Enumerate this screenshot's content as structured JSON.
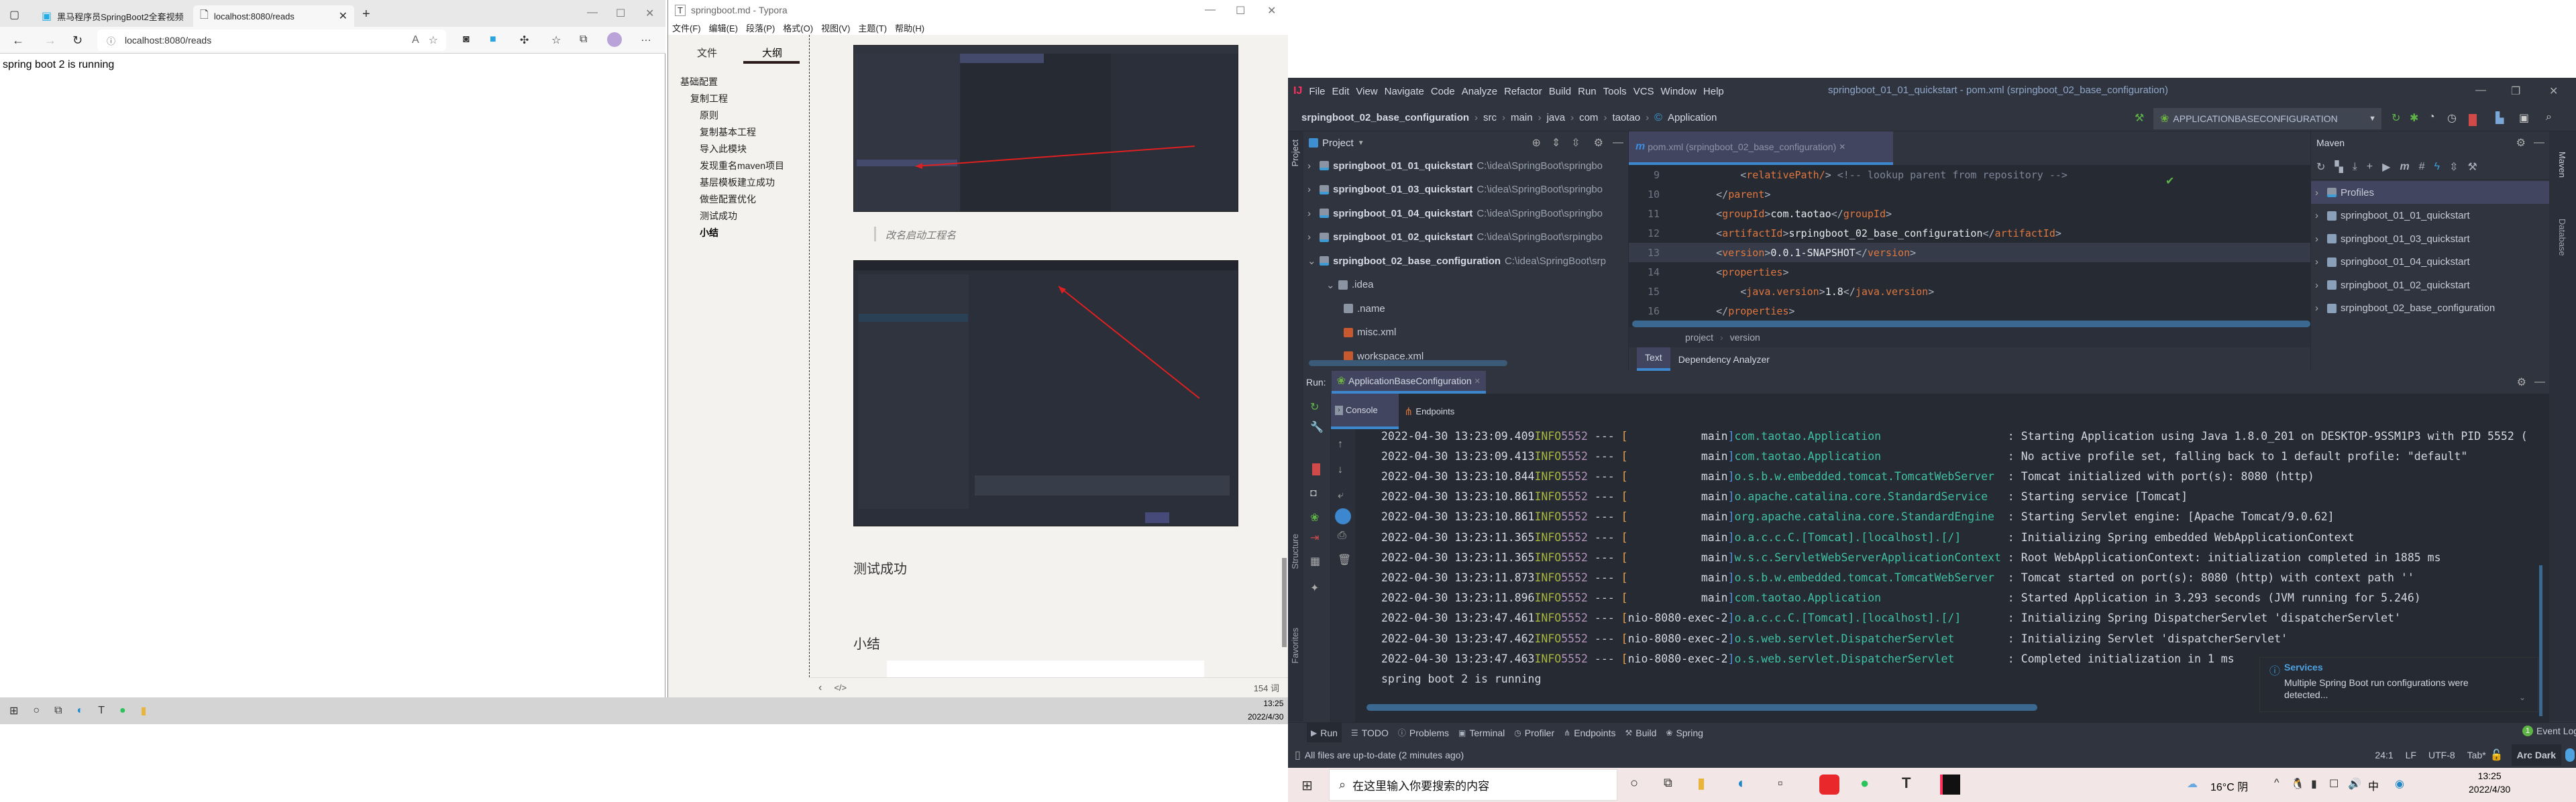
{
  "browser": {
    "tabs": [
      {
        "label": "黑马程序员SpringBoot2全套视频",
        "icon": "bilibili-icon"
      },
      {
        "label": "localhost:8080/reads",
        "icon": "page-icon"
      }
    ],
    "address": "localhost:8080/reads",
    "body_text": "spring boot 2 is running"
  },
  "typora": {
    "title": "springboot.md - Typora",
    "menu": [
      "文件(F)",
      "编辑(E)",
      "段落(P)",
      "格式(O)",
      "视图(V)",
      "主题(T)",
      "帮助(H)"
    ],
    "sidebar_tabs": [
      "文件",
      "大纲"
    ],
    "active_sidebar_tab": "大纲",
    "outline": [
      {
        "label": "基础配置",
        "level": 1
      },
      {
        "label": "复制工程",
        "level": 2
      },
      {
        "label": "原则",
        "level": 3
      },
      {
        "label": "复制基本工程",
        "level": 3
      },
      {
        "label": "导入此模块",
        "level": 3
      },
      {
        "label": "发现重名maven项目",
        "level": 3
      },
      {
        "label": "基层模板建立成功",
        "level": 3
      },
      {
        "label": "做些配置优化",
        "level": 3
      },
      {
        "label": "测试成功",
        "level": 3
      },
      {
        "label": "小结",
        "level": 3,
        "active": true
      }
    ],
    "caption": "改名启动工程名",
    "heading1": "测试成功",
    "heading2": "小结",
    "word_count": "154 词"
  },
  "idea": {
    "menu": [
      "File",
      "Edit",
      "View",
      "Navigate",
      "Code",
      "Analyze",
      "Refactor",
      "Build",
      "Run",
      "Tools",
      "VCS",
      "Window",
      "Help"
    ],
    "window_title": "springboot_01_01_quickstart - pom.xml (srpingboot_02_base_configuration)",
    "breadcrumb": [
      "srpingboot_02_base_configuration",
      "src",
      "main",
      "java",
      "com",
      "taotao",
      "Application"
    ],
    "run_config": "APPLICATIONBASECONFIGURATION",
    "project_label": "Project",
    "project_tree": [
      {
        "name": "springboot_01_01_quickstart",
        "path": "C:\\idea\\SpringBoot\\springbo",
        "expanded": false
      },
      {
        "name": "springboot_01_03_quickstart",
        "path": "C:\\idea\\SpringBoot\\springbo",
        "expanded": false
      },
      {
        "name": "springboot_01_04_quickstart",
        "path": "C:\\idea\\SpringBoot\\springbo",
        "expanded": false
      },
      {
        "name": "srpingboot_01_02_quickstart",
        "path": "C:\\idea\\SpringBoot\\srpingbo",
        "expanded": false
      },
      {
        "name": "srpingboot_02_base_configuration",
        "path": "C:\\idea\\SpringBoot\\srp",
        "expanded": true
      }
    ],
    "tree_children": [
      {
        "name": ".idea",
        "type": "folder"
      },
      {
        "name": ".name",
        "type": "file"
      },
      {
        "name": "misc.xml",
        "type": "xml"
      },
      {
        "name": "workspace.xml",
        "type": "xml"
      }
    ],
    "editor_tab": "pom.xml (srpingboot_02_base_configuration)",
    "code": [
      {
        "n": "9",
        "indent": "        ",
        "tag": "relativePath/",
        "rest": " <!-- lookup parent from repository -->"
      },
      {
        "n": "10",
        "indent": "    ",
        "close": "parent"
      },
      {
        "n": "11",
        "indent": "    ",
        "tag": "groupId",
        "val": "com.taotao"
      },
      {
        "n": "12",
        "indent": "    ",
        "tag": "artifactId",
        "val": "srpingboot_02_base_configuration"
      },
      {
        "n": "13",
        "indent": "    ",
        "tag": "version",
        "val": "0.0.1-SNAPSHOT",
        "current": true
      },
      {
        "n": "14",
        "indent": "    ",
        "open": "properties"
      },
      {
        "n": "15",
        "indent": "        ",
        "tag": "java.version",
        "val": "1.8"
      },
      {
        "n": "16",
        "indent": "    ",
        "close": "properties"
      }
    ],
    "editor_breadcrumb": [
      "project",
      "version"
    ],
    "editor_bottom_tabs": [
      "Text",
      "Dependency Analyzer"
    ],
    "maven": {
      "title": "Maven",
      "items": [
        "Profiles",
        "springboot_01_01_quickstart",
        "springboot_01_03_quickstart",
        "springboot_01_04_quickstart",
        "srpingboot_01_02_quickstart",
        "srpingboot_02_base_configuration"
      ]
    },
    "right_strip": [
      "Maven",
      "Database"
    ],
    "left_strip": [
      "Project",
      "Structure",
      "Favorites"
    ],
    "run": {
      "label": "Run:",
      "config": "ApplicationBaseConfiguration",
      "tabs": [
        "Console",
        "Endpoints"
      ]
    },
    "logs": [
      {
        "ts": "2022-04-30 13:23:09.409",
        "lv": "INFO",
        "pid": "5552",
        "th": "main",
        "lo": "com.taotao.Application",
        "msg": "Starting Application using Java 1.8.0_201 on DESKTOP-9SSM1P3 with PID 5552 ("
      },
      {
        "ts": "2022-04-30 13:23:09.413",
        "lv": "INFO",
        "pid": "5552",
        "th": "main",
        "lo": "com.taotao.Application",
        "msg": "No active profile set, falling back to 1 default profile: \"default\""
      },
      {
        "ts": "2022-04-30 13:23:10.844",
        "lv": "INFO",
        "pid": "5552",
        "th": "main",
        "lo": "o.s.b.w.embedded.tomcat.TomcatWebServer",
        "msg": "Tomcat initialized with port(s): 8080 (http)"
      },
      {
        "ts": "2022-04-30 13:23:10.861",
        "lv": "INFO",
        "pid": "5552",
        "th": "main",
        "lo": "o.apache.catalina.core.StandardService",
        "msg": "Starting service [Tomcat]"
      },
      {
        "ts": "2022-04-30 13:23:10.861",
        "lv": "INFO",
        "pid": "5552",
        "th": "main",
        "lo": "org.apache.catalina.core.StandardEngine",
        "msg": "Starting Servlet engine: [Apache Tomcat/9.0.62]"
      },
      {
        "ts": "2022-04-30 13:23:11.365",
        "lv": "INFO",
        "pid": "5552",
        "th": "main",
        "lo": "o.a.c.c.C.[Tomcat].[localhost].[/]",
        "msg": "Initializing Spring embedded WebApplicationContext"
      },
      {
        "ts": "2022-04-30 13:23:11.365",
        "lv": "INFO",
        "pid": "5552",
        "th": "main",
        "lo": "w.s.c.ServletWebServerApplicationContext",
        "msg": "Root WebApplicationContext: initialization completed in 1885 ms"
      },
      {
        "ts": "2022-04-30 13:23:11.873",
        "lv": "INFO",
        "pid": "5552",
        "th": "main",
        "lo": "o.s.b.w.embedded.tomcat.TomcatWebServer",
        "msg": "Tomcat started on port(s): 8080 (http) with context path ''"
      },
      {
        "ts": "2022-04-30 13:23:11.896",
        "lv": "INFO",
        "pid": "5552",
        "th": "main",
        "lo": "com.taotao.Application",
        "msg": "Started Application in 3.293 seconds (JVM running for 5.246)"
      },
      {
        "ts": "2022-04-30 13:23:47.461",
        "lv": "INFO",
        "pid": "5552",
        "th": "nio-8080-exec-2",
        "lo": "o.a.c.c.C.[Tomcat].[localhost].[/]",
        "msg": "Initializing Spring DispatcherServlet 'dispatcherServlet'"
      },
      {
        "ts": "2022-04-30 13:23:47.462",
        "lv": "INFO",
        "pid": "5552",
        "th": "nio-8080-exec-2",
        "lo": "o.s.web.servlet.DispatcherServlet",
        "msg": "Initializing Servlet 'dispatcherServlet'"
      },
      {
        "ts": "2022-04-30 13:23:47.463",
        "lv": "INFO",
        "pid": "5552",
        "th": "nio-8080-exec-2",
        "lo": "o.s.web.servlet.DispatcherServlet",
        "msg": "Completed initialization in 1 ms"
      }
    ],
    "stdout": "spring boot 2 is running",
    "services_popup": {
      "title": "Services",
      "text": "Multiple Spring Boot run configurations were detected..."
    },
    "bottom_tools": [
      "Run",
      "TODO",
      "Problems",
      "Terminal",
      "Profiler",
      "Endpoints",
      "Build",
      "Spring"
    ],
    "event_log": "Event Log",
    "event_count": "1",
    "status": {
      "message": "All files are up-to-date (2 minutes ago)",
      "position": "24:1",
      "line_sep": "LF",
      "encoding": "UTF-8",
      "indent": "Tab*",
      "theme": "Arc Dark"
    }
  },
  "taskbar_left": {
    "time": "13:25",
    "date": "2022/4/30"
  },
  "taskbar_right": {
    "search_placeholder": "在这里输入你要搜索的内容",
    "weather": "16°C 阴",
    "ime": "中",
    "time": "13:25",
    "date": "2022/4/30"
  },
  "colors": {
    "idea_bg": "#2f343f",
    "editor_bg": "#262a33",
    "accent": "#5294e2",
    "info": "#a9b73f",
    "logger": "#3fc1a5"
  }
}
